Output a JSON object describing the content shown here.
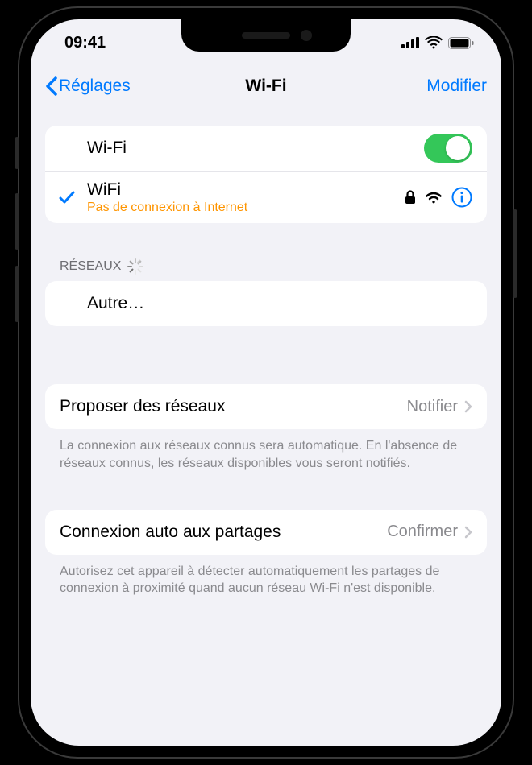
{
  "statusBar": {
    "time": "09:41"
  },
  "nav": {
    "back": "Réglages",
    "title": "Wi-Fi",
    "edit": "Modifier"
  },
  "wifiToggle": {
    "label": "Wi-Fi",
    "on": true
  },
  "connectedNetwork": {
    "name": "WiFi",
    "status": "Pas de connexion à Internet"
  },
  "networksHeader": "RÉSEAUX",
  "otherLabel": "Autre…",
  "askToJoin": {
    "label": "Proposer des réseaux",
    "value": "Notifier",
    "footer": "La connexion aux réseaux connus sera automatique. En l'absence de réseaux connus, les réseaux disponibles vous seront notifiés."
  },
  "autoHotspot": {
    "label": "Connexion auto aux partages",
    "value": "Confirmer",
    "footer": "Autorisez cet appareil à détecter automatiquement les partages de connexion à proximité quand aucun réseau Wi-Fi n'est disponible."
  },
  "colors": {
    "accent": "#007AFF",
    "warning": "#FF9500",
    "toggleOn": "#34C759"
  }
}
